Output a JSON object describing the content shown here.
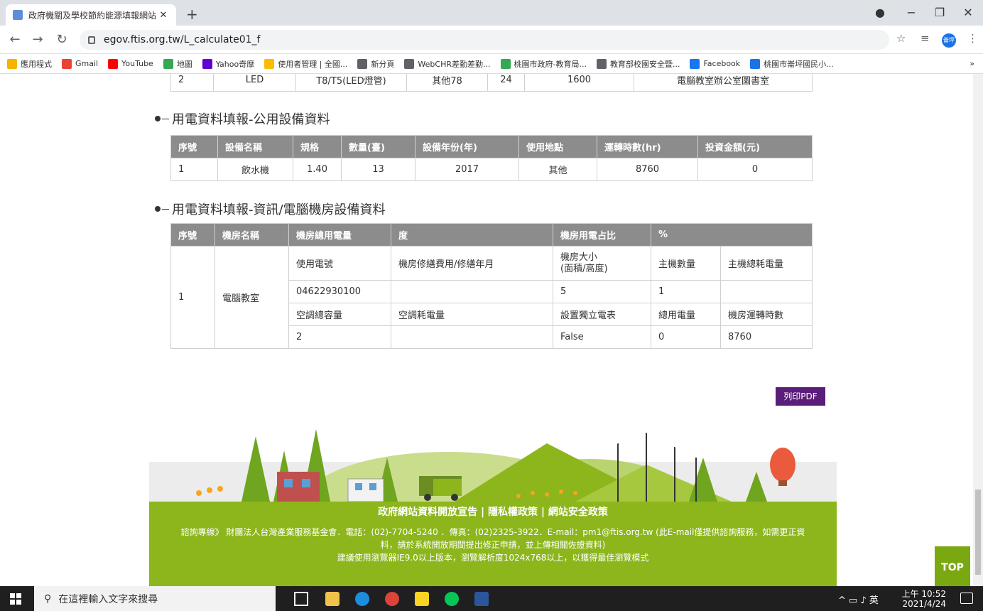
{
  "browser": {
    "tab_title": "政府機關及學校節約能源填報網站",
    "url": "egov.ftis.org.tw/L_calculate01_f",
    "avatar_text": "崙坪",
    "bookmarks": [
      "應用程式",
      "Gmail",
      "YouTube",
      "地圖",
      "Yahoo奇摩",
      "使用者管理 | 全國...",
      "新分頁",
      "WebCHR差勤差勤...",
      "桃園市政府-教育局...",
      "教育部校園安全暨...",
      "Facebook",
      "桃園市崙坪國民小..."
    ],
    "bookmark_colors": [
      "#f4b400",
      "#ea4335",
      "#ff0000",
      "#34a853",
      "#6001d2",
      "#fbbc05",
      "#5f6368",
      "#5f6368",
      "#34a853",
      "#5f6368",
      "#1877f2",
      "#1a73e8"
    ]
  },
  "top_partial_row": {
    "cells": [
      "2",
      "LED",
      "T8/T5(LED燈管)",
      "其他78",
      "24",
      "1600",
      "電腦教室辦公室圖書室"
    ]
  },
  "public_equipment": {
    "title": "用電資料填報-公用設備資料",
    "headers": [
      "序號",
      "設備名稱",
      "規格",
      "數量(臺)",
      "設備年份(年)",
      "使用地點",
      "運轉時數(hr)",
      "投資金額(元)"
    ],
    "rows": [
      [
        "1",
        "飲水機",
        "1.40",
        "13",
        "2017",
        "其他",
        "8760",
        "0"
      ]
    ]
  },
  "computer_room": {
    "title": "用電資料填報-資訊/電腦機房設備資料",
    "headers": [
      "序號",
      "機房名稱",
      "機房總用電量",
      "度",
      "機房用電占比",
      "%"
    ],
    "index": "1",
    "room_name": "電腦教室",
    "label_row1": [
      "使用電號",
      "機房修繕費用/修繕年月",
      "機房大小\n(面積/高度)",
      "主機數量",
      "主機總耗電量"
    ],
    "value_row1": [
      "04622930100",
      "",
      "5",
      "1",
      ""
    ],
    "label_row2": [
      "空調總容量",
      "空調耗電量",
      "設置獨立電表",
      "總用電量",
      "機房運轉時數"
    ],
    "value_row2": [
      "2",
      "",
      "False",
      "0",
      "8760"
    ]
  },
  "print_pdf_label": "列印PDF",
  "footer": {
    "links": "政府網站資料開放宣告 | 隱私權政策 | 網站安全政策",
    "info_line1": "諮詢專線》 財團法人台灣產業服務基金會．電話：(02)-7704-5240 ．傳真：(02)2325-3922．E-mail：pm1@ftis.org.tw (此E-mail僅提供諮詢服務，如需更正資",
    "info_line2": "料，請於系統開放期間提出修正申請，並上傳相關佐證資料)",
    "info_line3": "建議使用瀏覽器IE9.0以上版本，瀏覽解析度1024x768以上，以獲得最佳瀏覽模式"
  },
  "top_button": "TOP",
  "taskbar": {
    "search_placeholder": "在這裡輸入文字來搜尋",
    "ime": "英",
    "time_line1": "上午 10:52",
    "time_line2": "2021/4/24"
  }
}
